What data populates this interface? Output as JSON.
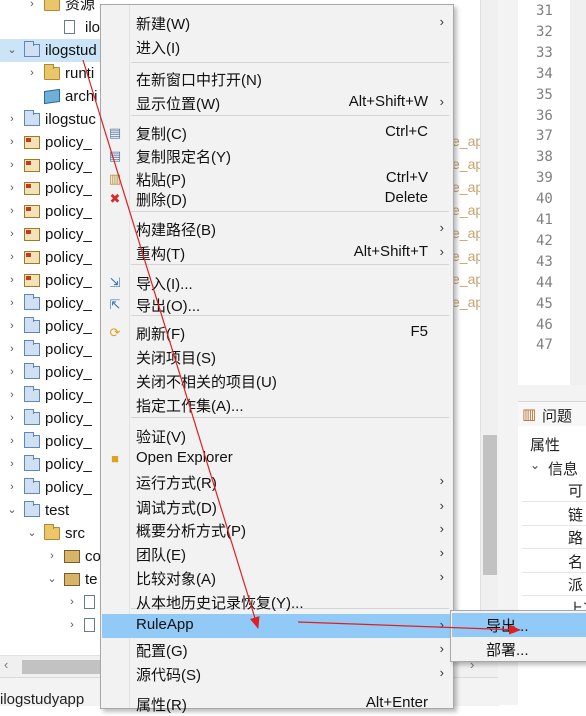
{
  "tree": {
    "rows": [
      {
        "label": "资源",
        "arrow": "›",
        "icon": "folder"
      },
      {
        "label": "ilogs",
        "arrow": "",
        "icon": "file"
      },
      {
        "label": "ilogstud",
        "arrow": "⌄",
        "icon": "project"
      },
      {
        "label": "runti",
        "arrow": "›",
        "icon": "folder"
      },
      {
        "label": "archi",
        "arrow": "",
        "icon": "cube"
      },
      {
        "label": "ilogstuc",
        "arrow": "›",
        "icon": "project"
      },
      {
        "label": "policy_",
        "arrow": "›",
        "icon": "policy"
      },
      {
        "label": "policy_",
        "arrow": "›",
        "icon": "policy"
      },
      {
        "label": "policy_",
        "arrow": "›",
        "icon": "policy"
      },
      {
        "label": "policy_",
        "arrow": "›",
        "icon": "policy"
      },
      {
        "label": "policy_",
        "arrow": "›",
        "icon": "policy"
      },
      {
        "label": "policy_",
        "arrow": "›",
        "icon": "policy"
      },
      {
        "label": "policy_",
        "arrow": "›",
        "icon": "policy"
      },
      {
        "label": "policy_",
        "arrow": "›",
        "icon": "project"
      },
      {
        "label": "policy_",
        "arrow": "›",
        "icon": "project"
      },
      {
        "label": "policy_",
        "arrow": "›",
        "icon": "project"
      },
      {
        "label": "policy_",
        "arrow": "›",
        "icon": "project"
      },
      {
        "label": "policy_",
        "arrow": "›",
        "icon": "project"
      },
      {
        "label": "policy_",
        "arrow": "›",
        "icon": "project"
      },
      {
        "label": "policy_",
        "arrow": "›",
        "icon": "project"
      },
      {
        "label": "policy_",
        "arrow": "›",
        "icon": "project"
      },
      {
        "label": "policy_",
        "arrow": "›",
        "icon": "project"
      },
      {
        "label": "test",
        "arrow": "⌄",
        "icon": "project"
      },
      {
        "label": "src",
        "arrow": "⌄",
        "icon": "folder"
      },
      {
        "label": "co",
        "arrow": "›",
        "icon": "package"
      },
      {
        "label": "te",
        "arrow": "⌄",
        "icon": "package"
      },
      {
        "label": "",
        "arrow": "›",
        "icon": "file"
      },
      {
        "label": "",
        "arrow": "›",
        "icon": "file"
      }
    ],
    "ghost_text": "e_ap",
    "status_text": "ilogstudyapp"
  },
  "editor": {
    "line_numbers": [
      "31",
      "32",
      "33",
      "34",
      "35",
      "36",
      "37",
      "38",
      "39",
      "40",
      "41",
      "42",
      "43",
      "44",
      "45",
      "46",
      "47"
    ]
  },
  "properties": {
    "tab_label": "问题",
    "header": "属性",
    "group": "信息",
    "cells": [
      "可",
      "链",
      "路",
      "名",
      "派",
      "上次"
    ]
  },
  "context_menu": {
    "items": [
      {
        "label": "新建(W)",
        "shortcut": "",
        "submenu": true,
        "icon": ""
      },
      {
        "label": "进入(I)",
        "shortcut": "",
        "submenu": false,
        "icon": ""
      },
      {
        "label": "在新窗口中打开(N)",
        "shortcut": "",
        "submenu": false,
        "icon": ""
      },
      {
        "label": "显示位置(W)",
        "shortcut": "Alt+Shift+W",
        "submenu": true,
        "icon": ""
      },
      {
        "label": "复制(C)",
        "shortcut": "Ctrl+C",
        "submenu": false,
        "icon": "copy"
      },
      {
        "label": "复制限定名(Y)",
        "shortcut": "",
        "submenu": false,
        "icon": "copy"
      },
      {
        "label": "粘贴(P)",
        "shortcut": "Ctrl+V",
        "submenu": false,
        "icon": "paste"
      },
      {
        "label": "删除(D)",
        "shortcut": "Delete",
        "submenu": false,
        "icon": "delete"
      },
      {
        "label": "构建路径(B)",
        "shortcut": "",
        "submenu": true,
        "icon": ""
      },
      {
        "label": "重构(T)",
        "shortcut": "Alt+Shift+T",
        "submenu": true,
        "icon": ""
      },
      {
        "label": "导入(I)...",
        "shortcut": "",
        "submenu": false,
        "icon": "import"
      },
      {
        "label": "导出(O)...",
        "shortcut": "",
        "submenu": false,
        "icon": "export"
      },
      {
        "label": "刷新(F)",
        "shortcut": "F5",
        "submenu": false,
        "icon": "refresh"
      },
      {
        "label": "关闭项目(S)",
        "shortcut": "",
        "submenu": false,
        "icon": ""
      },
      {
        "label": "关闭不相关的项目(U)",
        "shortcut": "",
        "submenu": false,
        "icon": ""
      },
      {
        "label": "指定工作集(A)...",
        "shortcut": "",
        "submenu": false,
        "icon": ""
      },
      {
        "label": "验证(V)",
        "shortcut": "",
        "submenu": false,
        "icon": ""
      },
      {
        "label": "Open Explorer",
        "shortcut": "",
        "submenu": false,
        "icon": "explorer"
      },
      {
        "label": "运行方式(R)",
        "shortcut": "",
        "submenu": true,
        "icon": ""
      },
      {
        "label": "调试方式(D)",
        "shortcut": "",
        "submenu": true,
        "icon": ""
      },
      {
        "label": "概要分析方式(P)",
        "shortcut": "",
        "submenu": true,
        "icon": ""
      },
      {
        "label": "团队(E)",
        "shortcut": "",
        "submenu": true,
        "icon": ""
      },
      {
        "label": "比较对象(A)",
        "shortcut": "",
        "submenu": true,
        "icon": ""
      },
      {
        "label": "从本地历史记录恢复(Y)...",
        "shortcut": "",
        "submenu": false,
        "icon": ""
      },
      {
        "label": "RuleApp",
        "shortcut": "",
        "submenu": true,
        "icon": "",
        "highlighted": true
      },
      {
        "label": "配置(G)",
        "shortcut": "",
        "submenu": true,
        "icon": ""
      },
      {
        "label": "源代码(S)",
        "shortcut": "",
        "submenu": true,
        "icon": ""
      },
      {
        "label": "属性(R)",
        "shortcut": "Alt+Enter",
        "submenu": false,
        "icon": ""
      }
    ]
  },
  "submenu": {
    "items": [
      {
        "label": "导出...",
        "highlighted": true
      },
      {
        "label": "部署..."
      }
    ]
  },
  "colors": {
    "menu_bg": "#f2f2f2",
    "highlight": "#91c9f7",
    "annotation_arrow": "#e02020"
  }
}
